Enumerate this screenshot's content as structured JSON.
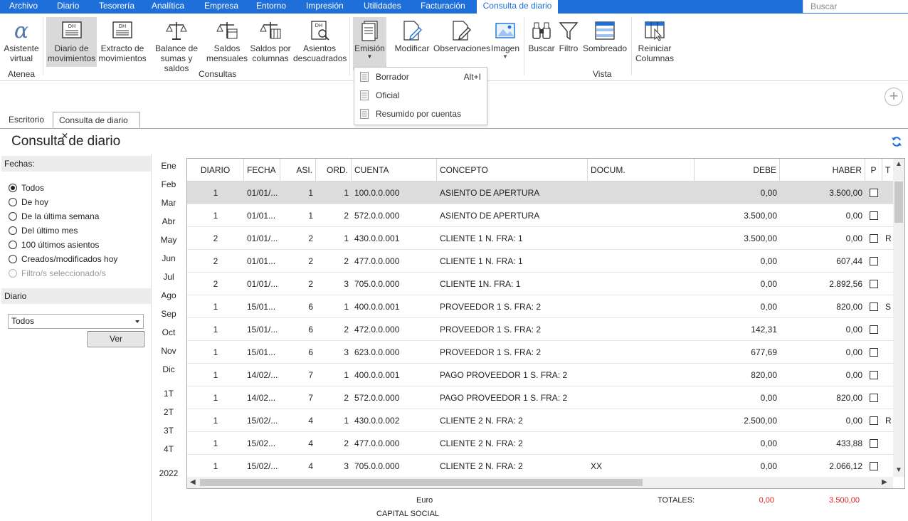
{
  "menu": {
    "items": [
      "Archivo",
      "Diario",
      "Tesorería",
      "Analítica",
      "Empresa",
      "Entorno",
      "Impresión",
      "Utilidades",
      "Facturación",
      "Consulta de diario"
    ],
    "search_placeholder": "Buscar",
    "accent": "#1e6fd9"
  },
  "ribbon": {
    "asistente": "Asistente virtual",
    "atenea_group": "Atenea",
    "diario_movimientos": "Diario de movimientos",
    "extracto": "Extracto de movimientos",
    "balance": "Balance de sumas y saldos",
    "saldos_mensuales": "Saldos mensuales",
    "saldos_columnas": "Saldos por columnas",
    "asientos_descuadrados": "Asientos descuadrados",
    "consultas_group": "Consultas",
    "emision": "Emisión",
    "modificar": "Modificar",
    "observaciones": "Observaciones",
    "imagen": "Imagen",
    "buscar": "Buscar",
    "filtro": "Filtro",
    "sombreado": "Sombreado",
    "vista_group": "Vista",
    "reiniciar": "Reiniciar Columnas"
  },
  "emision_menu": {
    "borrador": "Borrador",
    "borrador_shortcut": "Alt+I",
    "oficial": "Oficial",
    "resumido": "Resumido por cuentas"
  },
  "tabs": {
    "escritorio": "Escritorio",
    "consulta": "Consulta de diario",
    "close": "✕"
  },
  "page_title": "Consulta de diario",
  "filters": {
    "fechas_label": "Fechas:",
    "options": [
      "Todos",
      "De hoy",
      "De la última semana",
      "Del último mes",
      "100 últimos asientos",
      "Creados/modificados hoy",
      "Filtro/s seleccionado/s"
    ],
    "selected": "Todos",
    "diario_label": "Diario",
    "diario_value": "Todos",
    "ver_button": "Ver"
  },
  "periods": {
    "months": [
      "Ene",
      "Feb",
      "Mar",
      "Abr",
      "May",
      "Jun",
      "Jul",
      "Ago",
      "Sep",
      "Oct",
      "Nov",
      "Dic"
    ],
    "quarters": [
      "1T",
      "2T",
      "3T",
      "4T"
    ],
    "year": "2022"
  },
  "grid": {
    "columns": [
      "DIARIO",
      "FECHA",
      "ASI.",
      "ORD.",
      "CUENTA",
      "CONCEPTO",
      "DOCUM.",
      "DEBE",
      "HABER",
      "P",
      "T"
    ],
    "rows": [
      {
        "diario": "1",
        "fecha": "01/01/...",
        "asi": "1",
        "ord": "1",
        "cuenta": "100.0.0.000",
        "concepto": "ASIENTO DE APERTURA",
        "docum": "",
        "debe": "0,00",
        "haber": "3.500,00",
        "t": ""
      },
      {
        "diario": "1",
        "fecha": "01/01...",
        "asi": "1",
        "ord": "2",
        "cuenta": "572.0.0.000",
        "concepto": "ASIENTO DE APERTURA",
        "docum": "",
        "debe": "3.500,00",
        "haber": "0,00",
        "t": ""
      },
      {
        "diario": "2",
        "fecha": "01/01/...",
        "asi": "2",
        "ord": "1",
        "cuenta": "430.0.0.001",
        "concepto": "CLIENTE 1 N. FRA:  1",
        "docum": "",
        "debe": "3.500,00",
        "haber": "0,00",
        "t": "R"
      },
      {
        "diario": "2",
        "fecha": "01/01...",
        "asi": "2",
        "ord": "2",
        "cuenta": "477.0.0.000",
        "concepto": "CLIENTE 1 N. FRA:  1",
        "docum": "",
        "debe": "0,00",
        "haber": "607,44",
        "t": ""
      },
      {
        "diario": "2",
        "fecha": "01/01/...",
        "asi": "2",
        "ord": "3",
        "cuenta": "705.0.0.000",
        "concepto": "CLIENTE 1N. FRA:  1",
        "docum": "",
        "debe": "0,00",
        "haber": "2.892,56",
        "t": ""
      },
      {
        "diario": "1",
        "fecha": "15/01...",
        "asi": "6",
        "ord": "1",
        "cuenta": "400.0.0.001",
        "concepto": "PROVEEDOR 1 S. FRA:  2",
        "docum": "",
        "debe": "0,00",
        "haber": "820,00",
        "t": "S"
      },
      {
        "diario": "1",
        "fecha": "15/01/...",
        "asi": "6",
        "ord": "2",
        "cuenta": "472.0.0.000",
        "concepto": "PROVEEDOR 1 S. FRA:  2",
        "docum": "",
        "debe": "142,31",
        "haber": "0,00",
        "t": ""
      },
      {
        "diario": "1",
        "fecha": "15/01...",
        "asi": "6",
        "ord": "3",
        "cuenta": "623.0.0.000",
        "concepto": "PROVEEDOR 1 S. FRA:  2",
        "docum": "",
        "debe": "677,69",
        "haber": "0,00",
        "t": ""
      },
      {
        "diario": "1",
        "fecha": "14/02/...",
        "asi": "7",
        "ord": "1",
        "cuenta": "400.0.0.001",
        "concepto": "PAGO PROVEEDOR 1 S. FRA:  2",
        "docum": "",
        "debe": "820,00",
        "haber": "0,00",
        "t": ""
      },
      {
        "diario": "1",
        "fecha": "14/02...",
        "asi": "7",
        "ord": "2",
        "cuenta": "572.0.0.000",
        "concepto": "PAGO PROVEEDOR 1 S. FRA:  2",
        "docum": "",
        "debe": "0,00",
        "haber": "820,00",
        "t": ""
      },
      {
        "diario": "1",
        "fecha": "15/02/...",
        "asi": "4",
        "ord": "1",
        "cuenta": "430.0.0.002",
        "concepto": "CLIENTE 2 N. FRA:  2",
        "docum": "",
        "debe": "2.500,00",
        "haber": "0,00",
        "t": "R"
      },
      {
        "diario": "1",
        "fecha": "15/02...",
        "asi": "4",
        "ord": "2",
        "cuenta": "477.0.0.000",
        "concepto": "CLIENTE 2 N. FRA:  2",
        "docum": "",
        "debe": "0,00",
        "haber": "433,88",
        "t": ""
      },
      {
        "diario": "1",
        "fecha": "15/02/...",
        "asi": "4",
        "ord": "3",
        "cuenta": "705.0.0.000",
        "concepto": "CLIENTE 2 N. FRA:  2",
        "docum": "XX",
        "debe": "0,00",
        "haber": "2.066,12",
        "t": ""
      }
    ]
  },
  "footer": {
    "currency": "Euro",
    "account_name": "CAPITAL SOCIAL",
    "totales_label": "TOTALES:",
    "total_debe": "0,00",
    "total_haber": "3.500,00",
    "total_color": "#e02020"
  }
}
